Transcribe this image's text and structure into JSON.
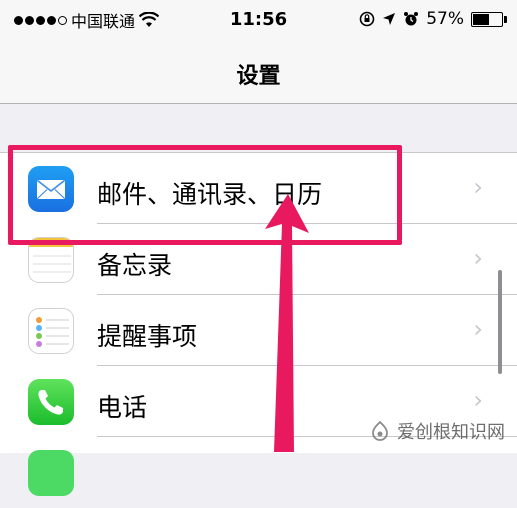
{
  "status_bar": {
    "carrier": "中国联通",
    "time": "11:56",
    "battery_text": "57%",
    "battery_level": 0.57
  },
  "nav": {
    "title": "设置"
  },
  "settings": [
    {
      "label": "邮件、通讯录、日历",
      "icon": "mail-icon"
    },
    {
      "label": "备忘录",
      "icon": "notes-icon"
    },
    {
      "label": "提醒事项",
      "icon": "reminders-icon"
    },
    {
      "label": "电话",
      "icon": "phone-icon"
    }
  ],
  "chevron": "›",
  "annotation": {
    "color": "#e8195f"
  },
  "watermark": {
    "text": "爱创根知识网"
  }
}
